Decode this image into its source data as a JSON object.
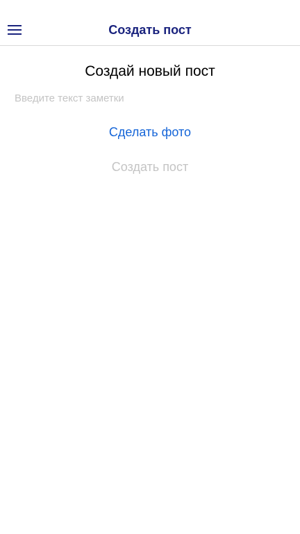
{
  "header": {
    "title": "Создать пост",
    "menu_icon": "hamburger-menu-icon",
    "title_color": "#1a237e"
  },
  "main": {
    "heading": "Создай новый пост",
    "note_input": {
      "value": "",
      "placeholder": "Введите текст заметки"
    },
    "take_photo_label": "Сделать фото",
    "create_post_label": "Создать пост",
    "accent_color": "#1565d8",
    "disabled_color": "#c4c4c4"
  }
}
